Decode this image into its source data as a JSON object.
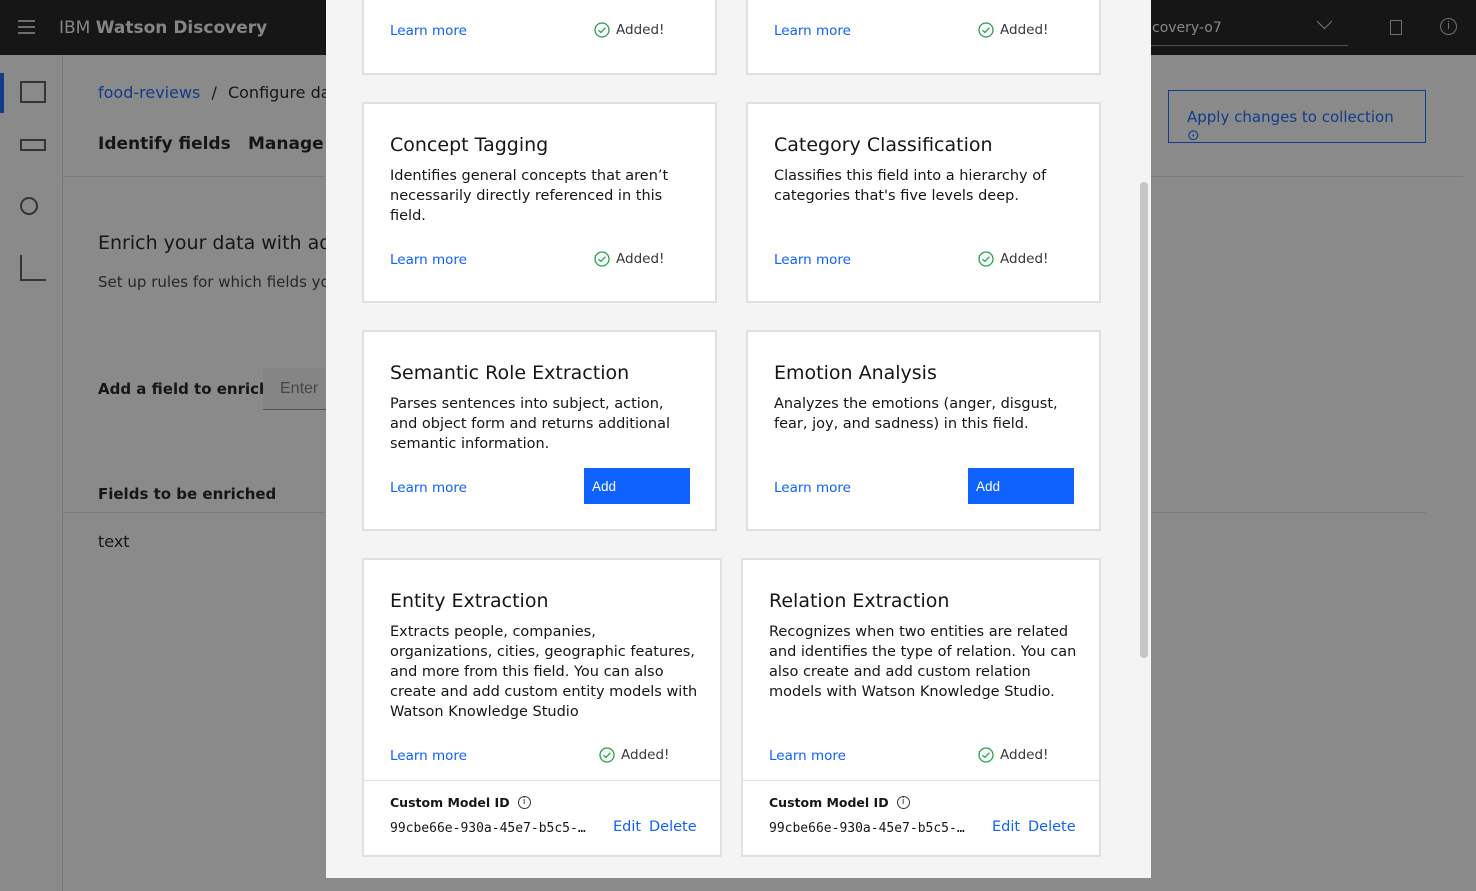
{
  "header": {
    "brand_prefix": "IBM",
    "brand_name": "Watson Discovery",
    "project_select": "covery-o7"
  },
  "breadcrumb": {
    "link": "food-reviews",
    "separator": "/",
    "current": "Configure data"
  },
  "tabs": [
    "Identify fields",
    "Manage fi"
  ],
  "apply_button": "Apply changes to collection",
  "enrich": {
    "title": "Enrich your data with addit",
    "subtitle": "Set up rules for which fields you"
  },
  "add_field": {
    "label": "Add a field to enrich",
    "placeholder": "Enter"
  },
  "fields": {
    "header": "Fields to be enriched",
    "items": [
      "text"
    ]
  },
  "colors": {
    "accent": "#0f62fe",
    "success": "#24a148"
  },
  "modal": {
    "top_cards": [
      {
        "learn_more": "Learn more",
        "status": "Added!"
      },
      {
        "learn_more": "Learn more",
        "status": "Added!"
      }
    ],
    "cards": [
      {
        "title": "Concept Tagging",
        "description": "Identifies general concepts that aren’t necessarily directly referenced in this field.",
        "learn_more": "Learn more",
        "status": "Added!"
      },
      {
        "title": "Category Classification",
        "description": "Classifies this field into a hierarchy of categories that's five levels deep.",
        "learn_more": "Learn more",
        "status": "Added!"
      },
      {
        "title": "Semantic Role Extraction",
        "description": "Parses sentences into subject, action, and object form and returns additional semantic information.",
        "learn_more": "Learn more",
        "action": "Add"
      },
      {
        "title": "Emotion Analysis",
        "description": "Analyzes the emotions (anger, disgust, fear, joy, and sadness) in this field.",
        "learn_more": "Learn more",
        "action": "Add"
      },
      {
        "title": "Entity Extraction",
        "description": "Extracts people, companies, organizations, cities, geographic features, and more from this field. You can also create and add custom entity models with Watson Knowledge Studio",
        "learn_more": "Learn more",
        "status": "Added!",
        "custom_model_label": "Custom Model ID",
        "custom_model_id": "99cbe66e-930a-45e7-b5c5-…",
        "edit": "Edit",
        "delete": "Delete"
      },
      {
        "title": "Relation Extraction",
        "description": "Recognizes when two entities are related and identifies the type of relation. You can also create and add custom relation models with Watson Knowledge Studio.",
        "learn_more": "Learn more",
        "status": "Added!",
        "custom_model_label": "Custom Model ID",
        "custom_model_id": "99cbe66e-930a-45e7-b5c5-…",
        "edit": "Edit",
        "delete": "Delete"
      }
    ]
  }
}
